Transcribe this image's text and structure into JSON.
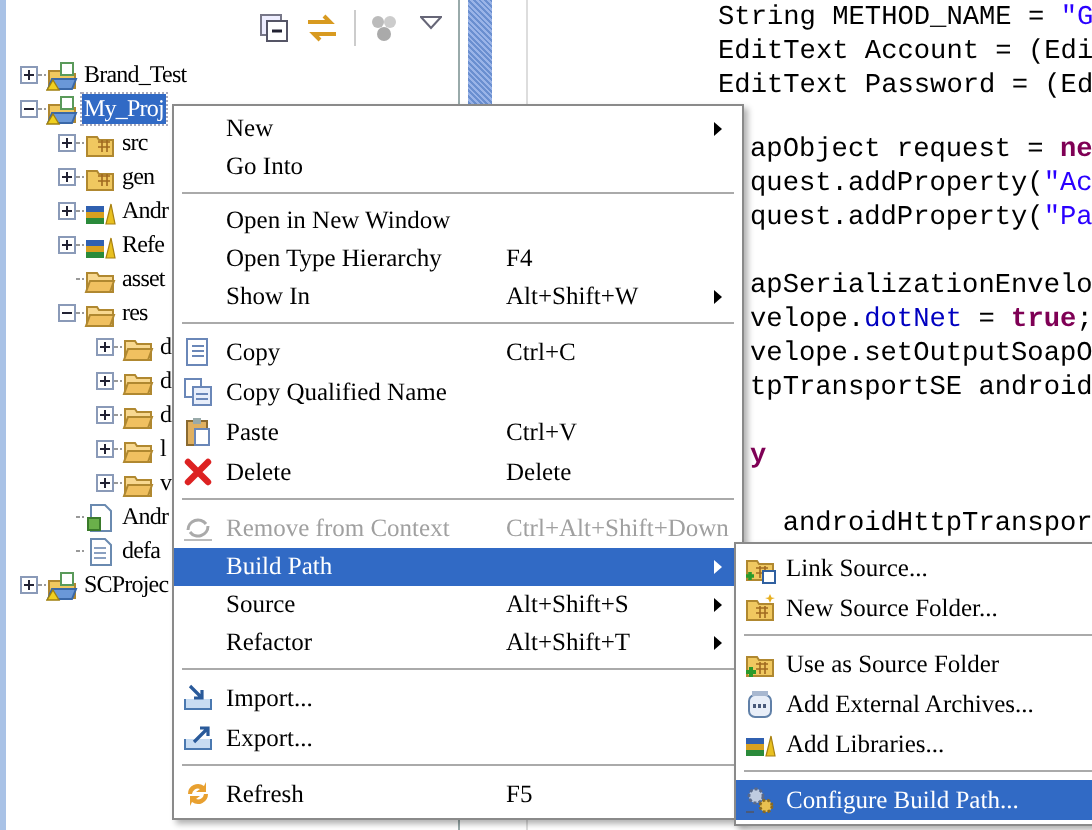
{
  "explorer": {
    "tree": [
      {
        "label": "Brand_Test",
        "kind": "project",
        "expanded": false,
        "selected": false
      },
      {
        "label": "My_Proj",
        "kind": "project",
        "expanded": true,
        "selected": true,
        "children": [
          {
            "label": "src",
            "kind": "source-folder",
            "expanded": false,
            "selected": false
          },
          {
            "label": "gen",
            "kind": "source-folder",
            "expanded": false,
            "selected": false
          },
          {
            "label": "Andr",
            "kind": "library",
            "expanded": false,
            "selected": false
          },
          {
            "label": "Refe",
            "kind": "library",
            "expanded": false,
            "selected": false
          },
          {
            "label": "asset",
            "kind": "folder",
            "selected": false
          },
          {
            "label": "res",
            "kind": "folder",
            "expanded": true,
            "selected": false,
            "children": [
              {
                "label": "d",
                "kind": "folder",
                "expanded": false,
                "selected": false
              },
              {
                "label": "d",
                "kind": "folder",
                "expanded": false,
                "selected": false
              },
              {
                "label": "d",
                "kind": "folder",
                "expanded": false,
                "selected": false
              },
              {
                "label": "l",
                "kind": "folder",
                "expanded": false,
                "selected": false
              },
              {
                "label": "v",
                "kind": "folder",
                "expanded": false,
                "selected": false
              }
            ]
          },
          {
            "label": "Andr",
            "kind": "manifest",
            "selected": false
          },
          {
            "label": "defa",
            "kind": "file",
            "selected": false
          }
        ]
      },
      {
        "label": "SCProjec",
        "kind": "project",
        "expanded": false,
        "selected": false
      }
    ]
  },
  "editor": {
    "lines": [
      {
        "segments": [
          {
            "kind": "plain",
            "text": "String METHOD_NAME = "
          },
          {
            "kind": "string",
            "text": "\"G"
          }
        ]
      },
      {
        "segments": [
          {
            "kind": "plain",
            "text": "EditText Account = (Edi"
          }
        ]
      },
      {
        "segments": [
          {
            "kind": "plain",
            "text": "EditText Password = (Ed"
          }
        ]
      }
    ],
    "blocks_beside_menu": [
      [
        {
          "segments": [
            {
              "kind": "plain",
              "text": "apObject request = "
            },
            {
              "kind": "keyword",
              "text": "ne"
            }
          ]
        },
        {
          "segments": [
            {
              "kind": "plain",
              "text": "quest.addProperty("
            },
            {
              "kind": "string",
              "text": "\"Ac"
            }
          ]
        },
        {
          "segments": [
            {
              "kind": "plain",
              "text": "quest.addProperty("
            },
            {
              "kind": "string",
              "text": "\"Pa"
            }
          ]
        }
      ],
      [
        {
          "segments": [
            {
              "kind": "plain",
              "text": "apSerializationEnvelo"
            }
          ]
        },
        {
          "segments": [
            {
              "kind": "plain",
              "text": "velope."
            },
            {
              "kind": "field",
              "text": "dotNet"
            },
            {
              "kind": "plain",
              "text": " = "
            },
            {
              "kind": "keyword",
              "text": "true"
            },
            {
              "kind": "plain",
              "text": ";"
            }
          ]
        },
        {
          "segments": [
            {
              "kind": "plain",
              "text": "velope.setOutputSoapO"
            }
          ]
        },
        {
          "segments": [
            {
              "kind": "plain",
              "text": "tpTransportSE android"
            }
          ]
        }
      ],
      [
        {
          "segments": [
            {
              "kind": "keyword",
              "text": "y"
            }
          ]
        }
      ],
      [
        {
          "segments": [
            {
              "kind": "plain",
              "text": "  androidHttpTranspor"
            }
          ]
        }
      ]
    ]
  },
  "context_menu": {
    "items": [
      {
        "kind": "item",
        "label": "New",
        "submenu": true,
        "disabled": false,
        "selected": false
      },
      {
        "kind": "item",
        "label": "Go Into",
        "submenu": false,
        "disabled": false,
        "selected": false
      },
      {
        "kind": "separator"
      },
      {
        "kind": "item",
        "label": "Open in New Window",
        "submenu": false,
        "disabled": false,
        "selected": false
      },
      {
        "kind": "item",
        "label": "Open Type Hierarchy",
        "shortcut": "F4",
        "submenu": false,
        "disabled": false,
        "selected": false
      },
      {
        "kind": "item",
        "label": "Show In",
        "shortcut": "Alt+Shift+W",
        "submenu": true,
        "disabled": false,
        "selected": false
      },
      {
        "kind": "separator"
      },
      {
        "kind": "item",
        "label": "Copy",
        "shortcut": "Ctrl+C",
        "submenu": false,
        "disabled": false,
        "selected": false
      },
      {
        "kind": "item",
        "label": "Copy Qualified Name",
        "submenu": false,
        "disabled": false,
        "selected": false
      },
      {
        "kind": "item",
        "label": "Paste",
        "shortcut": "Ctrl+V",
        "submenu": false,
        "disabled": false,
        "selected": false
      },
      {
        "kind": "item",
        "label": "Delete",
        "shortcut": "Delete",
        "submenu": false,
        "disabled": false,
        "selected": false
      },
      {
        "kind": "separator"
      },
      {
        "kind": "item",
        "label": "Remove from Context",
        "shortcut": "Ctrl+Alt+Shift+Down",
        "submenu": false,
        "disabled": true,
        "selected": false
      },
      {
        "kind": "item",
        "label": "Build Path",
        "submenu": true,
        "disabled": false,
        "selected": true
      },
      {
        "kind": "item",
        "label": "Source",
        "shortcut": "Alt+Shift+S",
        "submenu": true,
        "disabled": false,
        "selected": false
      },
      {
        "kind": "item",
        "label": "Refactor",
        "shortcut": "Alt+Shift+T",
        "submenu": true,
        "disabled": false,
        "selected": false
      },
      {
        "kind": "separator"
      },
      {
        "kind": "item",
        "label": "Import...",
        "submenu": false,
        "disabled": false,
        "selected": false
      },
      {
        "kind": "item",
        "label": "Export...",
        "submenu": false,
        "disabled": false,
        "selected": false
      },
      {
        "kind": "separator"
      },
      {
        "kind": "item",
        "label": "Refresh",
        "shortcut": "F5",
        "submenu": false,
        "disabled": false,
        "selected": false
      }
    ]
  },
  "build_path_submenu": {
    "items": [
      {
        "kind": "item",
        "label": "Link Source...",
        "selected": false
      },
      {
        "kind": "item",
        "label": "New Source Folder...",
        "selected": false
      },
      {
        "kind": "separator"
      },
      {
        "kind": "item",
        "label": "Use as Source Folder",
        "selected": false
      },
      {
        "kind": "item",
        "label": "Add External Archives...",
        "selected": false
      },
      {
        "kind": "item",
        "label": "Add Libraries...",
        "selected": false
      },
      {
        "kind": "separator"
      },
      {
        "kind": "item",
        "label": "Configure Build Path...",
        "selected": true
      }
    ]
  }
}
